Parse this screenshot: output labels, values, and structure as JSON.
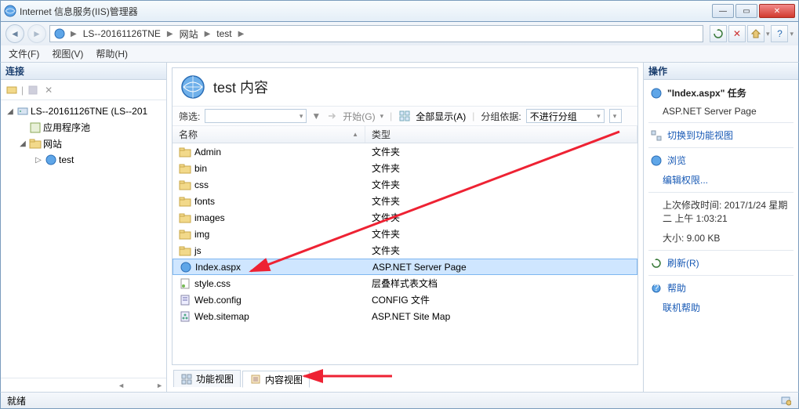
{
  "window": {
    "title": "Internet 信息服务(IIS)管理器"
  },
  "breadcrumb": {
    "root": "LS--20161126TNE",
    "site": "网站",
    "app": "test"
  },
  "menu": {
    "file": "文件(F)",
    "view": "视图(V)",
    "help": "帮助(H)"
  },
  "leftPanel": {
    "header": "连接",
    "server": "LS--20161126TNE (LS--201",
    "appPools": "应用程序池",
    "sites": "网站",
    "siteTest": "test"
  },
  "center": {
    "title": "test 内容",
    "filterLabel": "筛选:",
    "startLabel": "开始(G)",
    "showAll": "全部显示(A)",
    "groupByLabel": "分组依据:",
    "groupByValue": "不进行分组",
    "col1": "名称",
    "col2": "类型",
    "tabFeatures": "功能视图",
    "tabContent": "内容视图",
    "files": [
      {
        "name": "Admin",
        "type": "文件夹",
        "icon": "folder"
      },
      {
        "name": "bin",
        "type": "文件夹",
        "icon": "folder"
      },
      {
        "name": "css",
        "type": "文件夹",
        "icon": "folder"
      },
      {
        "name": "fonts",
        "type": "文件夹",
        "icon": "folder"
      },
      {
        "name": "images",
        "type": "文件夹",
        "icon": "folder"
      },
      {
        "name": "img",
        "type": "文件夹",
        "icon": "folder"
      },
      {
        "name": "js",
        "type": "文件夹",
        "icon": "folder"
      },
      {
        "name": "Index.aspx",
        "type": "ASP.NET Server Page",
        "icon": "aspx",
        "selected": true
      },
      {
        "name": "style.css",
        "type": "层叠样式表文档",
        "icon": "css"
      },
      {
        "name": "Web.config",
        "type": "CONFIG 文件",
        "icon": "config"
      },
      {
        "name": "Web.sitemap",
        "type": "ASP.NET Site Map",
        "icon": "sitemap"
      }
    ]
  },
  "right": {
    "header": "操作",
    "taskTitle": "\"Index.aspx\" 任务",
    "taskSub": "ASP.NET Server Page",
    "switchView": "切换到功能视图",
    "browse": "浏览",
    "editPerm": "编辑权限...",
    "modified": "上次修改时间: 2017/1/24 星期二 上午 1:03:21",
    "size": "大小: 9.00 KB",
    "refresh": "刷新(R)",
    "help": "帮助",
    "onlineHelp": "联机帮助"
  },
  "status": {
    "ready": "就绪"
  }
}
